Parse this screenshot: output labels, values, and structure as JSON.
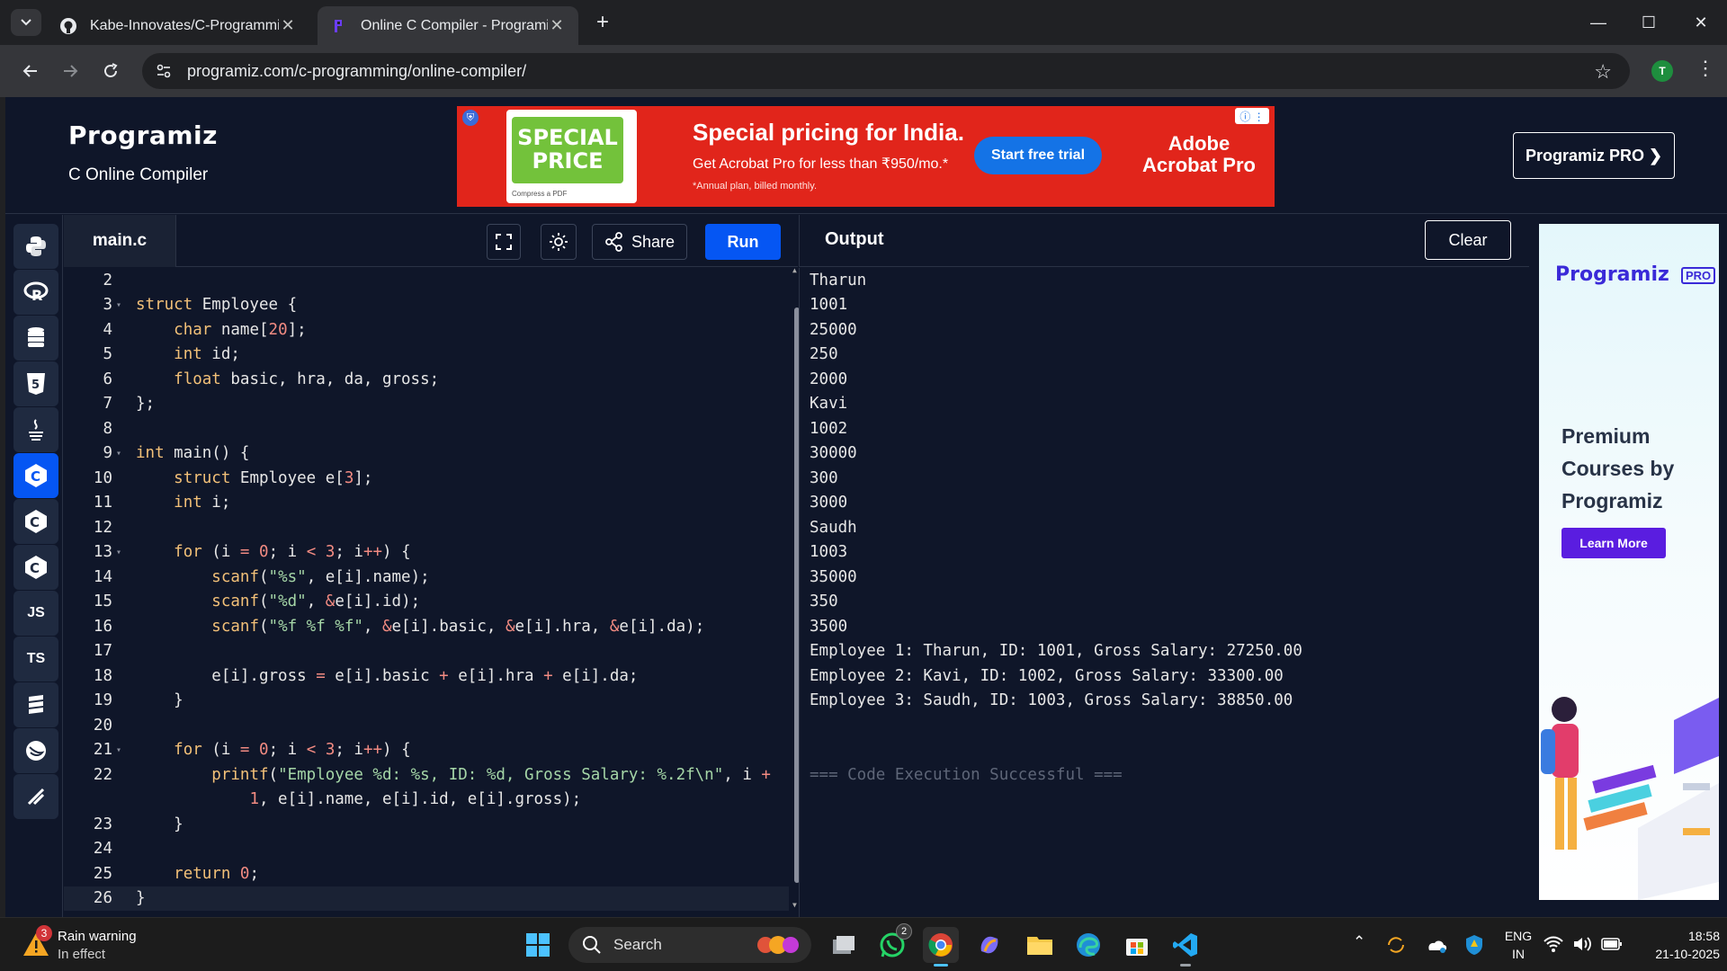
{
  "browser": {
    "tabs": [
      {
        "title": "Kabe-Innovates/C-Programmin",
        "favicon": "github-icon",
        "active": false
      },
      {
        "title": "Online C Compiler - Programiz",
        "favicon": "programiz-icon",
        "active": true
      }
    ],
    "url": "programiz.com/c-programming/online-compiler/",
    "profile_initial": "T"
  },
  "header": {
    "logo": "Programiz",
    "subtitle": "C Online Compiler",
    "pro_button": "Programiz PRO ❯"
  },
  "ad_banner": {
    "art_text": "SPECIAL PRICE",
    "art_caption": "Compress a PDF",
    "title": "Special pricing for India.",
    "text": "Get Acrobat Pro for less than ₹950/mo.*",
    "note": "*Annual plan, billed monthly.",
    "cta": "Start free trial",
    "brand": "Adobe Acrobat Pro"
  },
  "sidebar": {
    "items": [
      {
        "name": "python",
        "label": ""
      },
      {
        "name": "r",
        "label": ""
      },
      {
        "name": "sql",
        "label": ""
      },
      {
        "name": "html",
        "label": ""
      },
      {
        "name": "java",
        "label": ""
      },
      {
        "name": "c",
        "label": "",
        "active": true
      },
      {
        "name": "cpp",
        "label": ""
      },
      {
        "name": "csharp",
        "label": ""
      },
      {
        "name": "js",
        "label": "JS"
      },
      {
        "name": "ts",
        "label": "TS"
      },
      {
        "name": "go",
        "label": ""
      },
      {
        "name": "swift",
        "label": ""
      }
    ]
  },
  "editor": {
    "filename": "main.c",
    "share_label": "Share",
    "run_label": "Run",
    "code_lines": [
      {
        "n": "2",
        "fold": false,
        "html": ""
      },
      {
        "n": "3",
        "fold": true,
        "html": "<span class=\"kw\">struct</span> Employee {"
      },
      {
        "n": "4",
        "fold": false,
        "html": "    <span class=\"ty\">char</span> name[<span class=\"num\">20</span>];"
      },
      {
        "n": "5",
        "fold": false,
        "html": "    <span class=\"ty\">int</span> id;"
      },
      {
        "n": "6",
        "fold": false,
        "html": "    <span class=\"ty\">float</span> basic, hra, da, gross;"
      },
      {
        "n": "7",
        "fold": false,
        "html": "};"
      },
      {
        "n": "8",
        "fold": false,
        "html": ""
      },
      {
        "n": "9",
        "fold": true,
        "html": "<span class=\"ty\">int</span> main() {"
      },
      {
        "n": "10",
        "fold": false,
        "html": "    <span class=\"kw\">struct</span> Employee e[<span class=\"num\">3</span>];"
      },
      {
        "n": "11",
        "fold": false,
        "html": "    <span class=\"ty\">int</span> i;"
      },
      {
        "n": "12",
        "fold": false,
        "html": ""
      },
      {
        "n": "13",
        "fold": true,
        "html": "    <span class=\"kw\">for</span> (i <span class=\"op\">=</span> <span class=\"num\">0</span>; i <span class=\"op\">&lt;</span> <span class=\"num\">3</span>; i<span class=\"op\">++</span>) {"
      },
      {
        "n": "14",
        "fold": false,
        "html": "        <span class=\"kw\">scanf</span>(<span class=\"str\">\"%s\"</span>, e[i].name);"
      },
      {
        "n": "15",
        "fold": false,
        "html": "        <span class=\"kw\">scanf</span>(<span class=\"str\">\"%d\"</span>, <span class=\"op\">&amp;</span>e[i].id);"
      },
      {
        "n": "16",
        "fold": false,
        "html": "        <span class=\"kw\">scanf</span>(<span class=\"str\">\"%f %f %f\"</span>, <span class=\"op\">&amp;</span>e[i].basic, <span class=\"op\">&amp;</span>e[i].hra, <span class=\"op\">&amp;</span>e[i].da);"
      },
      {
        "n": "17",
        "fold": false,
        "html": ""
      },
      {
        "n": "18",
        "fold": false,
        "html": "        e[i].gross <span class=\"op\">=</span> e[i].basic <span class=\"op\">+</span> e[i].hra <span class=\"op\">+</span> e[i].da;"
      },
      {
        "n": "19",
        "fold": false,
        "html": "    }"
      },
      {
        "n": "20",
        "fold": false,
        "html": ""
      },
      {
        "n": "21",
        "fold": true,
        "html": "    <span class=\"kw\">for</span> (i <span class=\"op\">=</span> <span class=\"num\">0</span>; i <span class=\"op\">&lt;</span> <span class=\"num\">3</span>; i<span class=\"op\">++</span>) {"
      },
      {
        "n": "22",
        "fold": false,
        "html": "        <span class=\"kw\">printf</span>(<span class=\"str\">\"Employee %d: %s, ID: %d, Gross Salary: %.2f\\n\"</span>, i <span class=\"op\">+</span>"
      },
      {
        "n": "",
        "fold": false,
        "html": "            <span class=\"num\">1</span>, e[i].name, e[i].id, e[i].gross);"
      },
      {
        "n": "23",
        "fold": false,
        "html": "    }"
      },
      {
        "n": "24",
        "fold": false,
        "html": ""
      },
      {
        "n": "25",
        "fold": false,
        "html": "    <span class=\"kw\">return</span> <span class=\"num\">0</span>;"
      },
      {
        "n": "26",
        "fold": false,
        "html": "}",
        "current": true
      }
    ]
  },
  "output": {
    "title": "Output",
    "clear_label": "Clear",
    "lines": [
      "Tharun",
      "1001",
      "25000",
      "250",
      "2000",
      "Kavi",
      "1002",
      "30000",
      "300",
      "3000",
      "Saudh",
      "1003",
      "35000",
      "350",
      "3500",
      "Employee 1: Tharun, ID: 1001, Gross Salary: 27250.00",
      "Employee 2: Kavi, ID: 1002, Gross Salary: 33300.00",
      "Employee 3: Saudh, ID: 1003, Gross Salary: 38850.00",
      "",
      "",
      "=== Code Execution Successful ==="
    ]
  },
  "side_ad": {
    "logo": "Programiz",
    "badge": "PRO",
    "heading": "Premium Courses by Programiz",
    "cta": "Learn More"
  },
  "taskbar": {
    "weather_title": "Rain warning",
    "weather_sub": "In effect",
    "weather_badge": "3",
    "search_label": "Search",
    "whatsapp_badge": "2",
    "lang_line1": "ENG",
    "lang_line2": "IN",
    "time": "18:58",
    "date": "21-10-2025"
  },
  "colors": {
    "page_bg": "#0f1629",
    "run_blue": "#0556f3",
    "ad_red": "#e1251b"
  }
}
